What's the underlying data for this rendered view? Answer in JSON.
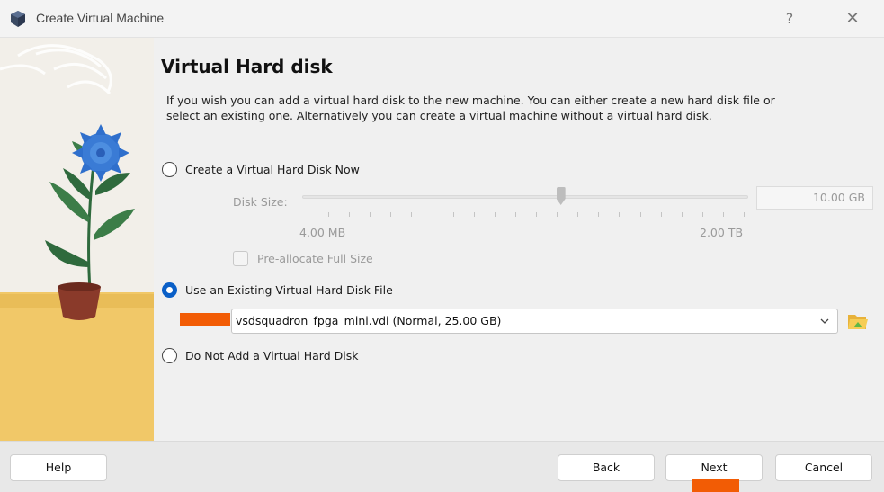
{
  "window": {
    "title": "Create Virtual Machine",
    "help_glyph": "?",
    "close_glyph": "✕"
  },
  "page": {
    "heading": "Virtual Hard disk",
    "description": "If you wish you can add a virtual hard disk to the new machine. You can either create a new hard disk file or select an existing one. Alternatively you can create a virtual machine without a virtual hard disk."
  },
  "options": {
    "create_new": {
      "label": "Create a Virtual Hard Disk Now",
      "selected": false
    },
    "use_existing": {
      "label": "Use an Existing Virtual Hard Disk File",
      "selected": true
    },
    "no_disk": {
      "label": "Do Not Add a Virtual Hard Disk",
      "selected": false
    }
  },
  "disk_size": {
    "label": "Disk Size:",
    "value": "10.00 GB",
    "min_label": "4.00 MB",
    "max_label": "2.00 TB",
    "slider_fraction": 0.58,
    "enabled": false
  },
  "preallocate": {
    "label": "Pre-allocate Full Size",
    "checked": false,
    "enabled": false
  },
  "existing_disk": {
    "selected": "vsdsquadron_fpga_mini.vdi (Normal, 25.00 GB)",
    "icons": {
      "dropdown": "chevron-down-icon",
      "browse": "folder-open-icon"
    }
  },
  "buttons": {
    "help": "Help",
    "back": "Back",
    "next": "Next",
    "cancel": "Cancel"
  },
  "colors": {
    "accent": "#0a5fc7",
    "redaction": "#f25c05"
  }
}
